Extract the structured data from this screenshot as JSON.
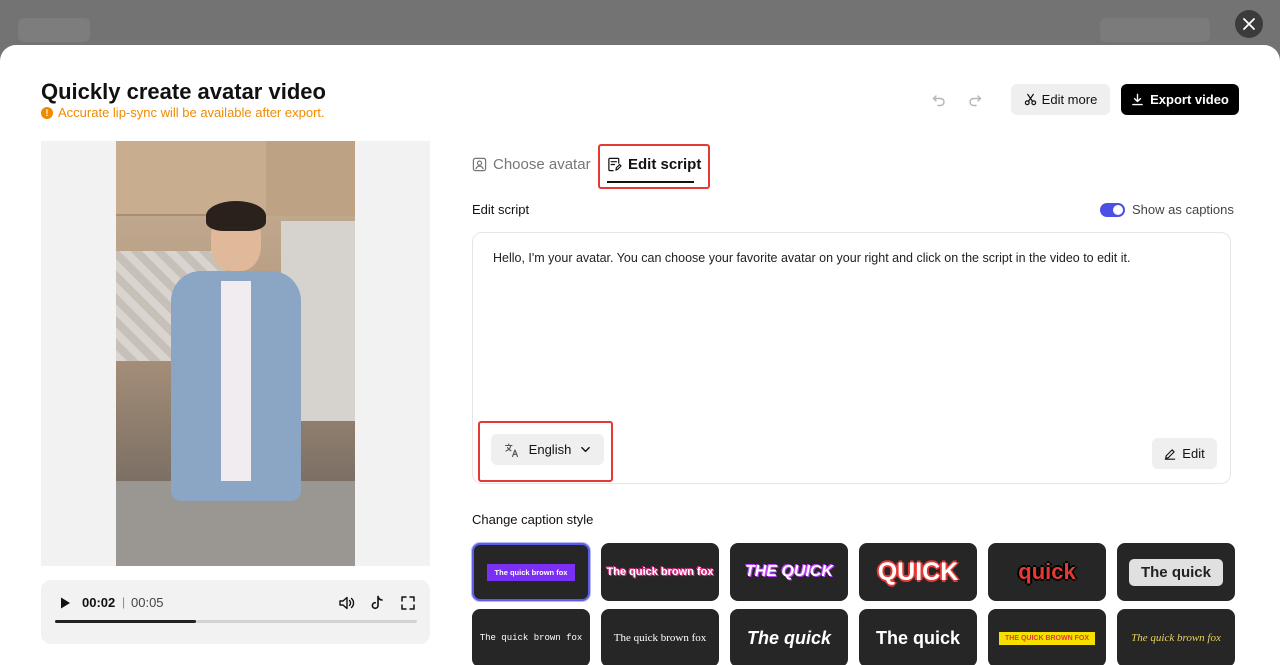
{
  "modal": {
    "title": "Quickly create avatar video",
    "warning": "Accurate lip-sync will be available after export.",
    "warning_icon": "!",
    "edit_more_label": "Edit more",
    "export_label": "Export video"
  },
  "player": {
    "current_time": "00:02",
    "separator": "|",
    "total_time": "00:05",
    "progress": 0.39
  },
  "tabs": [
    {
      "label": "Choose avatar",
      "active": false
    },
    {
      "label": "Edit script",
      "active": true
    }
  ],
  "script": {
    "section_label": "Edit script",
    "show_captions_label": "Show as captions",
    "show_captions_on": true,
    "text": "Hello, I'm your avatar. You can choose your favorite avatar on your right and click on the script in the video to edit it.",
    "language": "English",
    "edit_label": "Edit"
  },
  "caption_styles": {
    "section_label": "Change caption style",
    "row1": [
      "The quick brown fox",
      "The quick brown fox",
      "THE QUICK",
      "QUICK",
      "quick",
      "The quick"
    ],
    "row2": [
      "The quick brown fox",
      "The quick brown fox",
      "The quick",
      "The quick",
      "THE QUICK BROWN FOX",
      "The quick brown fox"
    ]
  },
  "colors": {
    "accent": "#4c4fe6",
    "warning": "#f08a00",
    "highlight_box": "#e53935"
  }
}
